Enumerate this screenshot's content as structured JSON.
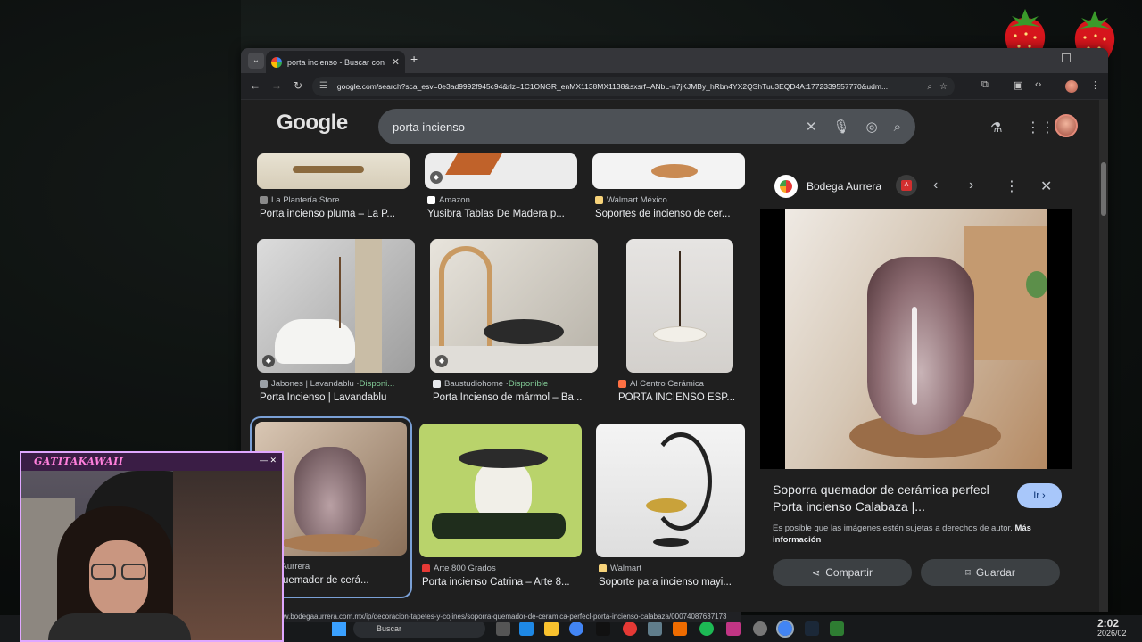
{
  "browser": {
    "tab_title": "porta incienso - Buscar con Google",
    "url": "google.com/search?sca_esv=0e3ad9992f945c94&rlz=1C1ONGR_enMX1138MX1138&sxsrf=ANbL-n7jKJMBy_hRbn4YX2QShTuu3EQD4A:1772339557770&udm..."
  },
  "google": {
    "logo": "Google",
    "query": "porta incienso"
  },
  "results": [
    {
      "source": "La Plantería Store",
      "title": "Porta incienso pluma – La P...",
      "fav": "#8a8a8a"
    },
    {
      "source": "Amazon",
      "title": "Yusibra Tablas De Madera p...",
      "fav": "#ffffff"
    },
    {
      "source": "Walmart México",
      "title": "Soportes de incienso de cer...",
      "fav": "#f7d37a"
    },
    {
      "source": "Jabones | Lavandablu · ",
      "availability": "Disponi...",
      "title": "Porta Incienso | Lavandablu",
      "fav": "#9aa0a6"
    },
    {
      "source": "Baustudiohome · ",
      "availability": "Disponible",
      "title": "Porta Incienso de mármol – Ba...",
      "fav": "#e8eaed"
    },
    {
      "source": "Al Centro Cerámica",
      "title": "PORTA INCIENSO ESP...",
      "fav": "#ff7043"
    },
    {
      "source": "odega Aurrera",
      "title": "orra quemador de cerá...",
      "fav": "#000000"
    },
    {
      "source": "Arte 800 Grados",
      "title": "Porta incienso Catrina – Arte 8...",
      "fav": "#e53935"
    },
    {
      "source": "Walmart",
      "title": "Soporte para incienso mayi...",
      "fav": "#f7d37a"
    }
  ],
  "panel": {
    "source": "Bodega Aurrera",
    "title": "Soporra quemador de cerámica perfecl Porta incienso Calabaza |...",
    "go_label": "Ir",
    "note": "Es posible que las imágenes estén sujetas a derechos de autor.",
    "note_link": "Más información",
    "share_label": "Compartir",
    "save_label": "Guardar"
  },
  "status_url": "ww.bodegaaurrera.com.mx/ip/decoracion-tapetes-y-cojines/soporra-quemador-de-ceramica-perfecl-porta-incienso-calabaza/00074087637173",
  "taskbar": {
    "search_label": "Buscar",
    "clock_time": "2:02",
    "clock_date": "2026/02"
  },
  "webcam": {
    "name": "GATITAKAWAII"
  }
}
